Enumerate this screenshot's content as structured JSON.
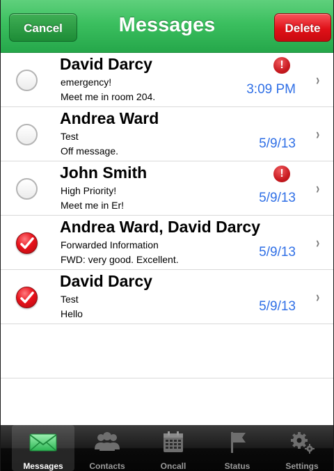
{
  "header": {
    "title": "Messages",
    "cancel_label": "Cancel",
    "delete_label": "Delete"
  },
  "messages": [
    {
      "sender": "David Darcy",
      "subject": "emergency!",
      "preview": "Meet me in room 204.",
      "date": "3:09 PM",
      "selected": false,
      "priority": true
    },
    {
      "sender": "Andrea Ward",
      "subject": "Test",
      "preview": "Off message.",
      "date": "5/9/13",
      "selected": false,
      "priority": false
    },
    {
      "sender": "John Smith",
      "subject": "High Priority!",
      "preview": "Meet me in Er!",
      "date": "5/9/13",
      "selected": false,
      "priority": true
    },
    {
      "sender": "Andrea Ward, David Darcy",
      "subject": "Forwarded Information",
      "preview": "FWD:  very good.  Excellent.",
      "date": "5/9/13",
      "selected": true,
      "priority": false
    },
    {
      "sender": "David Darcy",
      "subject": "Test",
      "preview": "Hello",
      "date": "5/9/13",
      "selected": true,
      "priority": false
    }
  ],
  "alert_glyph": "!",
  "chevron_glyph": "›",
  "tabs": [
    {
      "label": "Messages",
      "icon": "envelope-icon",
      "active": true
    },
    {
      "label": "Contacts",
      "icon": "people-icon",
      "active": false
    },
    {
      "label": "Oncall",
      "icon": "calendar-icon",
      "active": false
    },
    {
      "label": "Status",
      "icon": "flag-icon",
      "active": false
    },
    {
      "label": "Settings",
      "icon": "gears-icon",
      "active": false
    }
  ],
  "colors": {
    "header_green": "#3bbf5f",
    "delete_red": "#e01118",
    "date_blue": "#2f6fe6"
  }
}
